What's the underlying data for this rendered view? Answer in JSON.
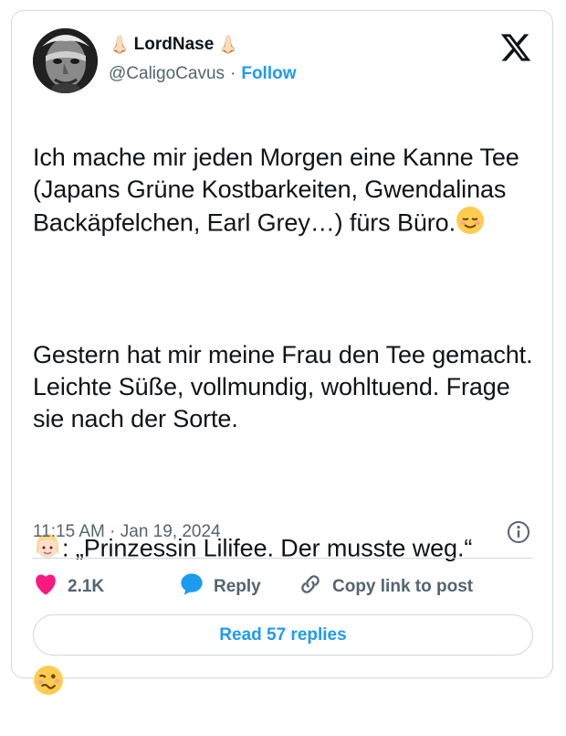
{
  "tweet": {
    "author": {
      "name_prefix": "👃🏻",
      "display_name": "LordNase",
      "name_suffix": "👃🏻",
      "handle": "@CaligoCavus",
      "separator": "·",
      "follow_label": "Follow"
    },
    "text": {
      "p1": "Ich mache mir jeden Morgen eine Kanne Tee (Japans Grüne Kostbarkeiten, Gwendalinas Backäpfelchen, Earl Grey…) fürs Büro.",
      "p2": "Gestern hat mir meine Frau den Tee gemacht. Leichte Süße, vollmundig, wohltuend. Frage sie nach der Sorte.",
      "p3": ": „Prinzessin Lilifee. Der musste weg.“"
    },
    "timestamp": "11:15 AM · Jan 19, 2024",
    "actions": {
      "likes_count": "2.1K",
      "reply_label": "Reply",
      "copy_link_label": "Copy link to post"
    },
    "read_replies_label": "Read 57 replies"
  },
  "colors": {
    "accent": "#1d9bf0",
    "heart": "#f91880",
    "secondary_text": "#536471",
    "border": "#cfd9de"
  },
  "icons": [
    "x-logo-icon",
    "relieved-face-emoji",
    "blonde-person-emoji",
    "woozy-face-emoji",
    "info-icon",
    "heart-icon",
    "reply-bubble-icon",
    "link-icon"
  ]
}
